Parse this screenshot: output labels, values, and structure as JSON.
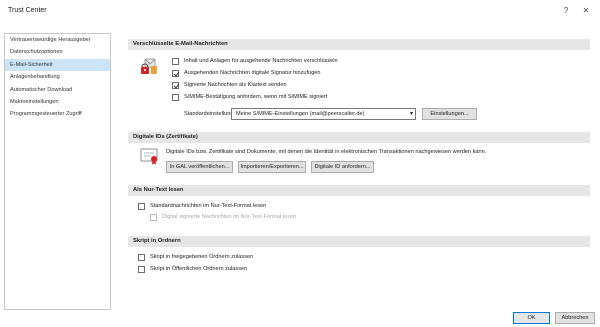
{
  "window": {
    "title": "Trust Center",
    "help_label": "?",
    "close_label": "✕"
  },
  "sidebar": {
    "items": [
      {
        "label": "Vertrauenswürdige Herausgeber"
      },
      {
        "label": "Datenschutzoptionen"
      },
      {
        "label": "E-Mail-Sicherheit"
      },
      {
        "label": "Anlagenbehandlung"
      },
      {
        "label": "Automatischer Download"
      },
      {
        "label": "Makroeinstellungen"
      },
      {
        "label": "Programmgesteuerter Zugriff"
      }
    ],
    "selected_index": 2
  },
  "sections": {
    "encrypted": {
      "heading": "Verschlüsselte E-Mail-Nachrichten",
      "icon": "encrypted-mail-lock-icon",
      "options": [
        {
          "label": "Inhalt und Anlagen für ausgehende Nachrichten verschlüsseln",
          "checked": false
        },
        {
          "label": "Ausgehenden Nachrichten digitale Signatur hinzufügen",
          "checked": true
        },
        {
          "label": "Signierte Nachrichten als Klartext senden",
          "checked": true
        },
        {
          "label": "S/MIME-Bestätigung anfordern, wenn mit S/MIME signiert",
          "checked": false
        }
      ],
      "default_setting_label": "Standardeinstellung:",
      "default_setting_value": "Meine S/MIME-Einstellungen (mail@peerscalter.de)",
      "settings_button": "Einstellungen..."
    },
    "digital_ids": {
      "heading": "Digitale IDs (Zertifikate)",
      "icon": "certificate-icon",
      "description": "Digitale IDs bzw. Zertifikate sind Dokumente, mit denen die Identität in elektronischen Transaktionen nachgewiesen werden kann.",
      "buttons": {
        "publish_gal": "In GAL veröffentlichen...",
        "import_export": "Importieren/Exportieren...",
        "get_digital_id": "Digitale ID anfordern..."
      }
    },
    "plain_text": {
      "heading": "Als Nur-Text lesen",
      "options": [
        {
          "label": "Standardnachrichten im Nur-Text-Format lesen",
          "checked": false,
          "disabled": false
        },
        {
          "label": "Digital signierte Nachrichten im Nur-Text-Format lesen",
          "checked": false,
          "disabled": true
        }
      ]
    },
    "script_folders": {
      "heading": "Skript in Ordnern",
      "options": [
        {
          "label": "Skript in freigegebenen Ordnern zulassen",
          "checked": false
        },
        {
          "label": "Skript in Öffentlichen Ordnern zulassen",
          "checked": false
        }
      ]
    }
  },
  "footer": {
    "ok_label": "OK",
    "cancel_label": "Abbrechen"
  },
  "colors": {
    "selected_item_bg": "#cce4f7",
    "section_header_bg": "#e6e6e6",
    "ok_border": "#0078d7"
  }
}
